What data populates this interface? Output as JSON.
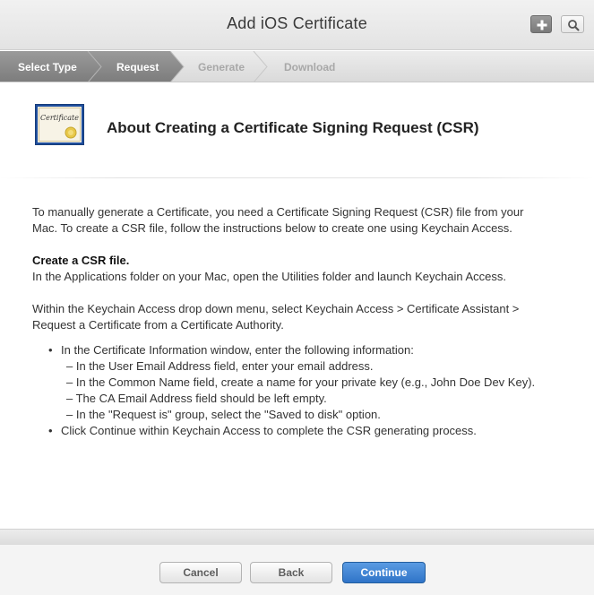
{
  "header": {
    "title": "Add iOS Certificate",
    "add_icon": "plus-icon",
    "search_icon": "search-icon"
  },
  "steps": [
    {
      "label": "Select Type",
      "state": "active"
    },
    {
      "label": "Request",
      "state": "active"
    },
    {
      "label": "Generate",
      "state": "inactive"
    },
    {
      "label": "Download",
      "state": "inactive"
    }
  ],
  "intro": {
    "icon": "certificate-icon",
    "icon_text": "Certificate",
    "title": "About Creating a Certificate Signing Request (CSR)"
  },
  "content": {
    "intro_lines": [
      "To manually generate a Certificate, you need a Certificate Signing Request (CSR) file from your",
      "Mac. To create a CSR file, follow the instructions below to create one using Keychain Access."
    ],
    "section_heading": "Create a CSR file.",
    "section_text": "In the Applications folder on your Mac, open the Utilities folder and launch Keychain Access.",
    "menu_lines": [
      "Within the Keychain Access drop down menu, select Keychain Access > Certificate Assistant >",
      "Request a Certificate from a Certificate Authority."
    ],
    "bullets": [
      {
        "text": "In the Certificate Information window, enter the following information:",
        "sub": [
          "– In the User Email Address field, enter your email address.",
          "– In the Common Name field, create a name for your private key (e.g., John Doe Dev Key).",
          "– The CA Email Address field should be left empty.",
          "– In the \"Request is\" group, select the \"Saved to disk\" option."
        ]
      },
      {
        "text": "Click Continue within Keychain Access to complete the CSR generating process.",
        "sub": []
      }
    ]
  },
  "footer": {
    "cancel_label": "Cancel",
    "back_label": "Back",
    "continue_label": "Continue"
  },
  "colors": {
    "step_active": "#8a8a8a",
    "step_inactive": "#e3e3e3",
    "primary_button": "#3a7fd0"
  }
}
